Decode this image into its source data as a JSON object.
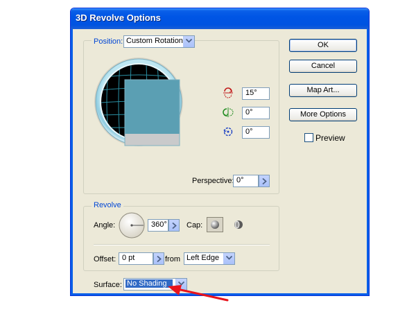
{
  "window": {
    "title": "3D Revolve Options"
  },
  "position": {
    "group_label": "Position:",
    "dropdown_value": "Custom Rotation",
    "rotation_x": "15°",
    "rotation_y": "0°",
    "rotation_z": "0°",
    "perspective_label": "Perspective:",
    "perspective_value": "0°"
  },
  "revolve": {
    "group_label": "Revolve",
    "angle_label": "Angle:",
    "angle_value": "360°",
    "cap_label": "Cap:",
    "offset_label": "Offset:",
    "offset_value": "0 pt",
    "from_label": "from",
    "from_value": "Left Edge"
  },
  "surface": {
    "label": "Surface:",
    "value": "No Shading"
  },
  "buttons": {
    "ok": "OK",
    "cancel": "Cancel",
    "map_art": "Map Art...",
    "more_options": "More Options"
  },
  "preview": {
    "label": "Preview",
    "checked": false
  },
  "colors": {
    "titlebar": "#0055e5",
    "dialog_bg": "#ece9d8",
    "group_label": "#0046d5",
    "annotation_arrow": "#e8141c"
  },
  "icons": {
    "rotate_x": "rotate-x-axis-icon",
    "rotate_y": "rotate-y-axis-icon",
    "rotate_z": "rotate-z-axis-icon",
    "cap_on": "cap-on-icon",
    "cap_off": "cap-off-icon",
    "angle_dial": "angle-dial-icon",
    "annotation": "red-arrow-annotation"
  }
}
